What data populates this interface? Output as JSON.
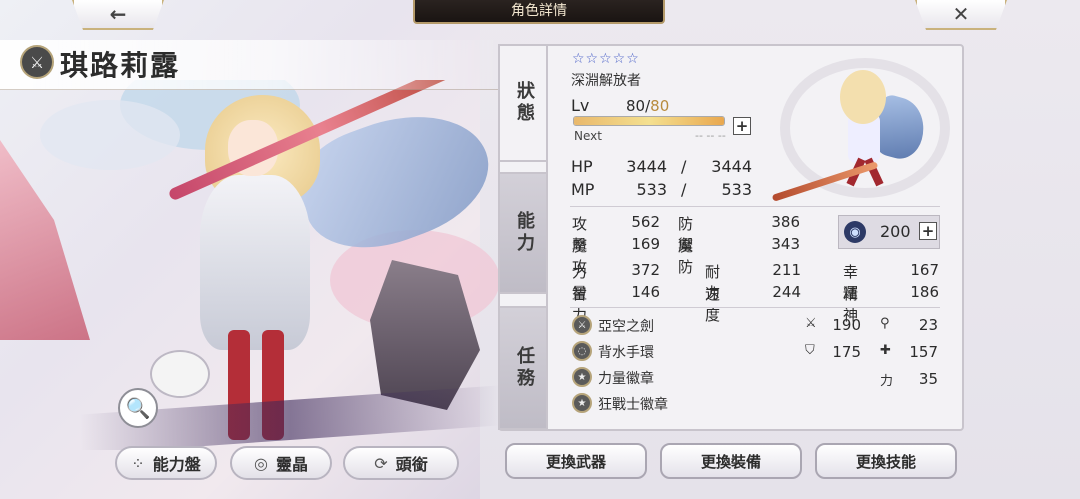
{
  "header": {
    "title": "角色詳情",
    "back_icon": "←",
    "close_icon": "✕"
  },
  "character": {
    "name": "琪路莉露",
    "weapon_type_icon": "sword-icon",
    "stars": "☆☆☆☆☆",
    "job": "深淵解放者",
    "level_label": "Lv",
    "level": "80",
    "level_sep": "/",
    "level_max": "80",
    "exp_progress": 1.0,
    "next_label": "Next",
    "next_value": "-- -- --"
  },
  "tabs": {
    "status": "狀態",
    "ability": "能力",
    "quest": "任務"
  },
  "stats": {
    "hp_label": "HP",
    "hp": "3444",
    "hp_max": "3444",
    "mp_label": "MP",
    "mp": "533",
    "mp_max": "533",
    "slash": "/",
    "atk_label": "攻擊",
    "atk": "562",
    "def_label": "防禦",
    "def": "386",
    "matk_label": "魔攻",
    "matk": "169",
    "mdef_label": "魔防",
    "mdef": "343",
    "str_label": "力量",
    "str": "372",
    "vit_label": "耐力",
    "vit": "211",
    "luk_label": "幸運",
    "luk": "167",
    "int_label": "智力",
    "int": "146",
    "spd_label": "速度",
    "spd": "244",
    "spr_label": "精神",
    "spr": "186",
    "skill_points": "200"
  },
  "equipment": [
    {
      "name": "亞空之劍",
      "icon": "sword-icon"
    },
    {
      "name": "背水手環",
      "icon": "bracelet-icon"
    },
    {
      "name": "力量徽章",
      "icon": "badge-icon"
    },
    {
      "name": "狂戰士徽章",
      "icon": "badge-icon"
    }
  ],
  "equip_stats": {
    "atk": "190",
    "matk": "23",
    "def": "175",
    "mdef": "157",
    "str_label": "力",
    "str": "35"
  },
  "bottom_buttons": {
    "ability_board": "能力盤",
    "crystal": "靈晶",
    "title": "頭銜"
  },
  "action_buttons": {
    "weapon": "更換武器",
    "equip": "更換裝備",
    "skill": "更換技能"
  },
  "colors": {
    "accent_gold": "#b88b3e",
    "star_blue": "#4a61c8",
    "tab_dark": "#1a1412"
  }
}
